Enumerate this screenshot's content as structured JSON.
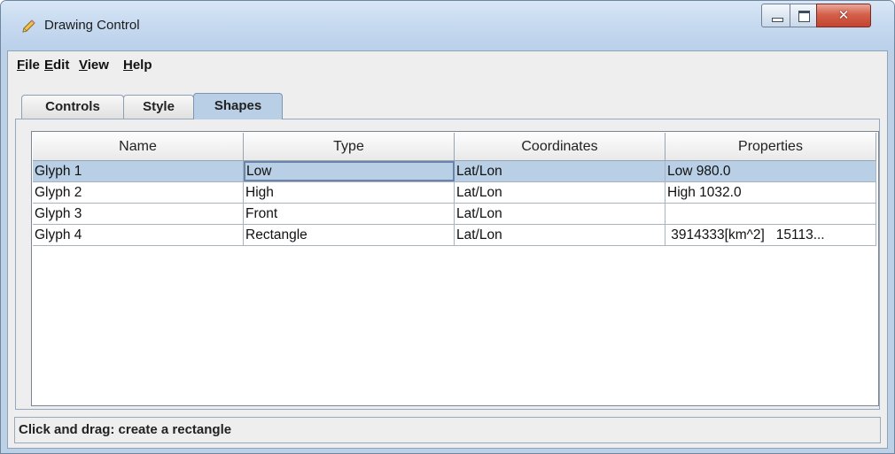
{
  "window": {
    "title": "Drawing Control",
    "app_icon": "pencil-icon",
    "controls": {
      "minimize": "minimize-icon",
      "maximize": "maximize-icon",
      "close": "close-icon"
    }
  },
  "menubar": {
    "items": [
      {
        "mnemonic": "F",
        "rest": "ile"
      },
      {
        "mnemonic": "E",
        "rest": "dit"
      },
      {
        "mnemonic": "V",
        "rest": "iew"
      },
      {
        "mnemonic": "H",
        "rest": "elp"
      }
    ]
  },
  "tabs": {
    "items": [
      "Controls",
      "Style",
      "Shapes"
    ],
    "selected": "Shapes"
  },
  "table": {
    "headers": [
      "Name",
      "Type",
      "Coordinates",
      "Properties"
    ],
    "rows": [
      [
        "Glyph 1",
        "Low",
        "Lat/Lon",
        "Low 980.0"
      ],
      [
        "Glyph 2",
        "High",
        "Lat/Lon",
        "High 1032.0"
      ],
      [
        "Glyph 3",
        "Front",
        "Lat/Lon",
        ""
      ],
      [
        "Glyph 4",
        "Rectangle",
        "Lat/Lon",
        " 3914333[km^2]   15113..."
      ]
    ],
    "selected_row": 0
  },
  "status": {
    "text": "Click and drag: create a rectangle"
  },
  "colors": {
    "selection": "#b8cfe5",
    "titlebar": "#c7daf0",
    "close_button": "#c24530"
  }
}
